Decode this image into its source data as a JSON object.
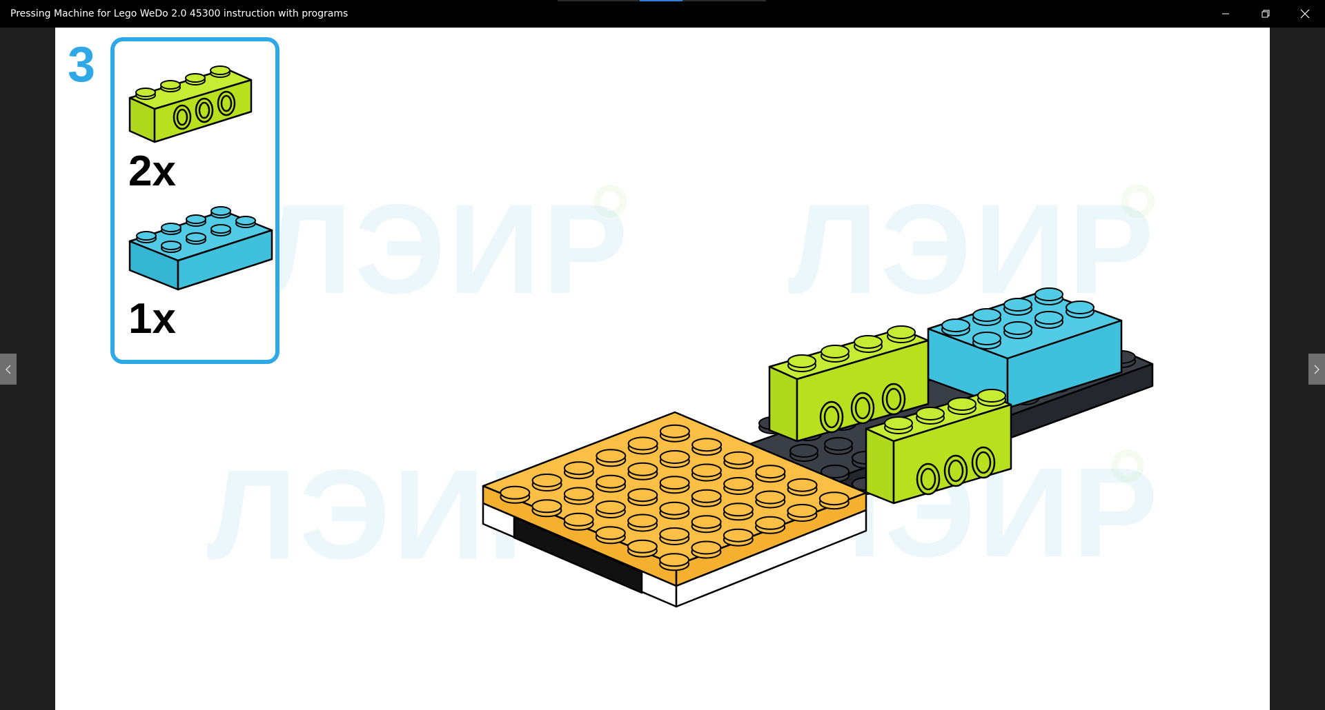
{
  "window": {
    "title": "Pressing Machine for Lego WeDo 2.0 45300 instruction with programs",
    "controls": {
      "minimize": "minimize-icon",
      "maximize": "restore-icon",
      "close": "close-icon"
    }
  },
  "viewer": {
    "step_number": "3",
    "parts": [
      {
        "name": "lime green 1x4 technic brick with 3 holes",
        "color": "#b8e01e",
        "quantity": "2x"
      },
      {
        "name": "medium azure 2x4 brick",
        "color": "#3fc0dc",
        "quantity": "1x"
      }
    ],
    "watermark": "ЛЭИР",
    "nav": {
      "prev_icon": "chevron-left-icon",
      "next_icon": "chevron-right-icon"
    }
  },
  "colors": {
    "accent_blue": "#2fa8e8",
    "lime": "#b8e01e",
    "azure": "#3fc0dc",
    "orange": "#f9b53a",
    "black_plate": "#2a2d33",
    "watermark": "#6cc7e6"
  }
}
